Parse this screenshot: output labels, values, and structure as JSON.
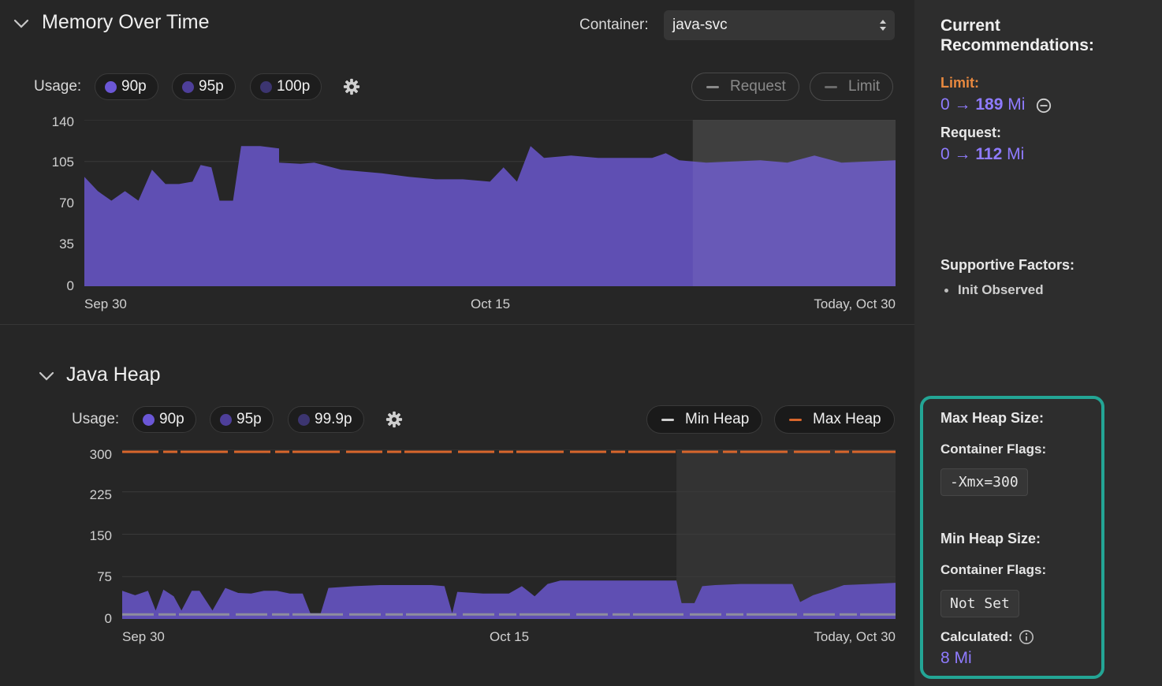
{
  "memory": {
    "title": "Memory Over Time",
    "container_label": "Container:",
    "container_value": "java-svc",
    "usage_label": "Usage:",
    "pills": [
      {
        "label": "90p",
        "color": "#6b57d6"
      },
      {
        "label": "95p",
        "color": "#4e3f9a"
      },
      {
        "label": "100p",
        "color": "#3c3570"
      }
    ],
    "request_label": "Request",
    "limit_label": "Limit",
    "y_ticks": [
      "140",
      "105",
      "70",
      "35",
      "0"
    ],
    "x_ticks": [
      "Sep 30",
      "Oct 15",
      "Today, Oct 30"
    ]
  },
  "heap": {
    "title": "Java Heap",
    "usage_label": "Usage:",
    "pills": [
      {
        "label": "90p",
        "color": "#6b57d6"
      },
      {
        "label": "95p",
        "color": "#4e3f9a"
      },
      {
        "label": "99.9p",
        "color": "#3c3570"
      }
    ],
    "min_heap_label": "Min Heap",
    "max_heap_label": "Max Heap",
    "max_heap_color": "#d8662c",
    "y_ticks": [
      "300",
      "225",
      "150",
      "75",
      "0"
    ],
    "x_ticks": [
      "Sep 30",
      "Oct 15",
      "Today, Oct 30"
    ]
  },
  "side": {
    "title_line1": "Current",
    "title_line2": "Recommendations:",
    "limit_label": "Limit:",
    "limit_from": "0",
    "limit_arrow": "→",
    "limit_to": "189",
    "limit_unit": "Mi",
    "request_label": "Request:",
    "request_from": "0",
    "request_arrow": "→",
    "request_to": "112",
    "request_unit": "Mi",
    "supportive_label": "Supportive Factors:",
    "supportive_items": [
      "Init Observed"
    ],
    "max_heap_title": "Max Heap Size:",
    "max_flags_label": "Container Flags:",
    "max_flags_value": "-Xmx=300",
    "min_heap_title": "Min Heap Size:",
    "min_flags_label": "Container Flags:",
    "min_flags_value": "Not Set",
    "calculated_label": "Calculated:",
    "calculated_value": "8 Mi"
  },
  "chart_data": [
    {
      "type": "area",
      "y_range": [
        0,
        140
      ],
      "x_range": [
        "Sep 30",
        "Oct 30"
      ],
      "x_ticks": [
        "Sep 30",
        "Oct 15",
        "Today, Oct 30"
      ],
      "y_ticks": [
        0,
        35,
        70,
        105,
        140
      ],
      "grid": true,
      "series": [
        {
          "name": "90p",
          "points": [
            [
              0,
              92
            ],
            [
              0.5,
              80
            ],
            [
              1,
              72
            ],
            [
              1.5,
              80
            ],
            [
              2,
              72
            ],
            [
              2.5,
              98
            ],
            [
              3,
              86
            ],
            [
              3.5,
              86
            ],
            [
              4,
              88
            ],
            [
              4.3,
              102
            ],
            [
              4.7,
              100
            ],
            [
              5,
              72
            ],
            [
              5.5,
              72
            ],
            [
              5.8,
              118
            ],
            [
              6.5,
              118
            ],
            [
              7.2,
              116
            ],
            [
              7.2,
              104
            ],
            [
              8,
              103
            ],
            [
              8.5,
              104
            ],
            [
              9.5,
              98
            ],
            [
              10,
              97
            ],
            [
              11,
              95
            ],
            [
              12,
              92
            ],
            [
              13,
              90
            ],
            [
              14,
              90
            ],
            [
              15,
              88
            ],
            [
              15.5,
              100
            ],
            [
              16,
              88
            ],
            [
              16.5,
              118
            ],
            [
              17,
              108
            ],
            [
              18,
              110
            ],
            [
              19,
              108
            ],
            [
              20,
              108
            ],
            [
              21,
              108
            ],
            [
              21.5,
              112
            ],
            [
              22,
              106
            ],
            [
              23,
              104
            ],
            [
              24,
              105
            ],
            [
              25,
              106
            ],
            [
              26,
              104
            ],
            [
              27,
              110
            ],
            [
              28,
              104
            ],
            [
              29,
              105
            ],
            [
              30,
              106
            ]
          ]
        }
      ],
      "highlight_from": 22.5
    },
    {
      "type": "area",
      "y_range": [
        0,
        300
      ],
      "x_range": [
        "Sep 30",
        "Oct 30"
      ],
      "x_ticks": [
        "Sep 30",
        "Oct 15",
        "Today, Oct 30"
      ],
      "y_ticks": [
        0,
        75,
        150,
        225,
        300
      ],
      "grid": true,
      "series": [
        {
          "name": "90p",
          "points": [
            [
              0,
              50
            ],
            [
              0.5,
              42
            ],
            [
              1,
              50
            ],
            [
              1.3,
              15
            ],
            [
              1.6,
              52
            ],
            [
              2,
              40
            ],
            [
              2.3,
              15
            ],
            [
              2.7,
              50
            ],
            [
              3,
              50
            ],
            [
              3.5,
              15
            ],
            [
              4,
              55
            ],
            [
              4.5,
              46
            ],
            [
              5,
              45
            ],
            [
              5.5,
              50
            ],
            [
              6,
              50
            ],
            [
              6.5,
              45
            ],
            [
              7,
              45
            ],
            [
              7.3,
              10
            ],
            [
              7.7,
              10
            ],
            [
              8,
              55
            ],
            [
              9,
              58
            ],
            [
              10,
              60
            ],
            [
              11,
              60
            ],
            [
              12,
              60
            ],
            [
              12.5,
              58
            ],
            [
              12.8,
              10
            ],
            [
              13,
              48
            ],
            [
              14,
              45
            ],
            [
              15,
              45
            ],
            [
              15.5,
              58
            ],
            [
              16,
              40
            ],
            [
              16.5,
              62
            ],
            [
              17,
              68
            ],
            [
              18,
              68
            ],
            [
              19,
              68
            ],
            [
              20,
              68
            ],
            [
              21,
              68
            ],
            [
              21.5,
              68
            ],
            [
              21.7,
              28
            ],
            [
              22.2,
              28
            ],
            [
              22.5,
              58
            ],
            [
              23,
              60
            ],
            [
              24,
              62
            ],
            [
              25,
              62
            ],
            [
              26,
              62
            ],
            [
              26.3,
              30
            ],
            [
              26.8,
              42
            ],
            [
              27.5,
              52
            ],
            [
              28,
              60
            ],
            [
              29,
              62
            ],
            [
              30,
              64
            ]
          ]
        },
        {
          "name": "Max Heap",
          "constant": 300
        },
        {
          "name": "Min Heap",
          "constant": 8
        }
      ],
      "highlight_from": 21.5
    }
  ]
}
